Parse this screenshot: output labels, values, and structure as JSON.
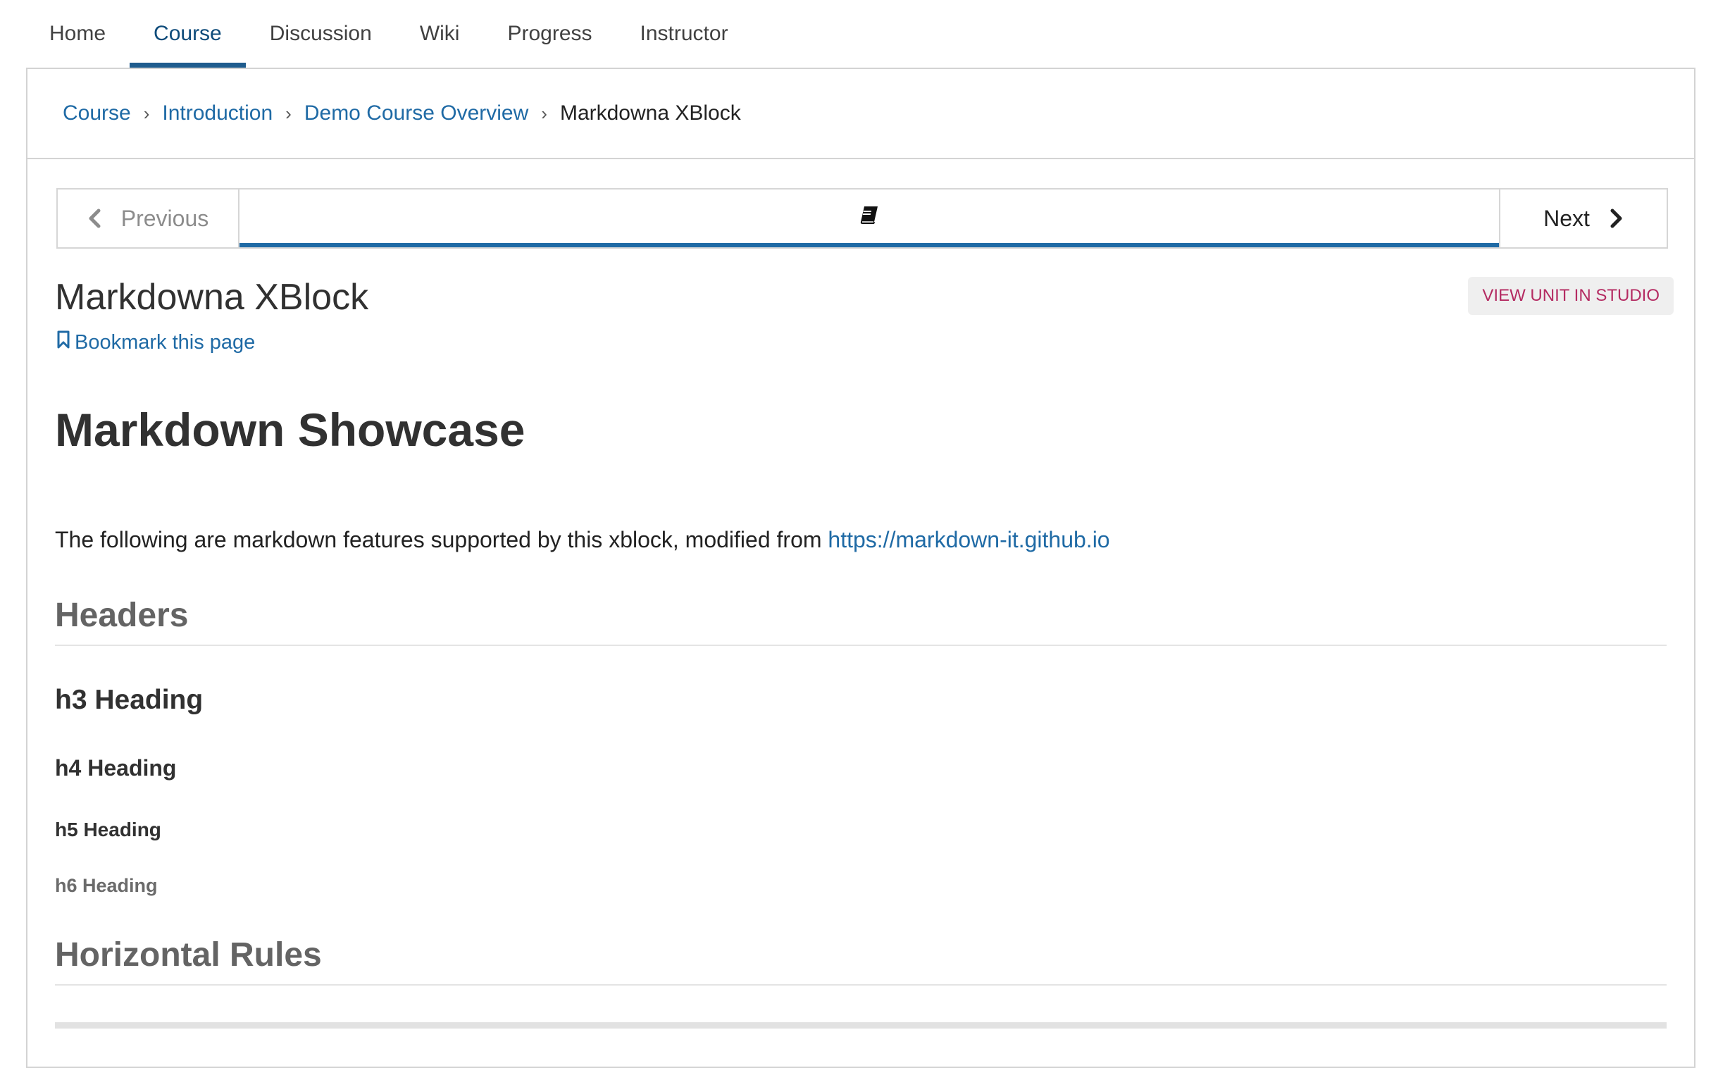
{
  "tabs": [
    {
      "label": "Home",
      "active": false
    },
    {
      "label": "Course",
      "active": true
    },
    {
      "label": "Discussion",
      "active": false
    },
    {
      "label": "Wiki",
      "active": false
    },
    {
      "label": "Progress",
      "active": false
    },
    {
      "label": "Instructor",
      "active": false
    }
  ],
  "breadcrumb": {
    "items": [
      "Course",
      "Introduction",
      "Demo Course Overview"
    ],
    "separator": "›",
    "current": "Markdowna XBlock"
  },
  "sequence_nav": {
    "previous_label": "Previous",
    "next_label": "Next",
    "unit_icon": "book-icon"
  },
  "unit": {
    "title": "Markdowna XBlock",
    "bookmark_label": "Bookmark this page",
    "studio_button_label": "VIEW UNIT IN STUDIO"
  },
  "content": {
    "h1": "Markdown Showcase",
    "intro_text": "The following are markdown features supported by this xblock, modified from ",
    "intro_link": "https://markdown-it.github.io",
    "section_headers": "Headers",
    "h3": "h3 Heading",
    "h4": "h4 Heading",
    "h5": "h5 Heading",
    "h6": "h6 Heading",
    "section_rules": "Horizontal Rules"
  },
  "colors": {
    "link": "#1f6aa5",
    "active_tab": "#0e4b7a",
    "studio_text": "#b42b62"
  }
}
